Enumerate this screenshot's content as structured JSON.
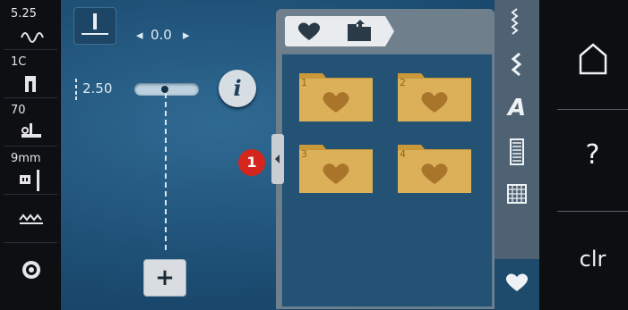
{
  "left_sidebar": {
    "items": [
      {
        "label": "5.25",
        "icon": "stitch-length-icon"
      },
      {
        "label": "1C",
        "icon": "presser-foot-icon"
      },
      {
        "label": "70",
        "icon": "needle-tension-icon"
      },
      {
        "label": "9mm",
        "icon": "stitch-width-plate-icon"
      },
      {
        "label": "",
        "icon": "feed-dog-icon"
      },
      {
        "label": "",
        "icon": "bobbin-thread-icon"
      }
    ]
  },
  "stitch_view": {
    "needle_position_value": "0.0",
    "stitch_width_value": "2.50",
    "info_label": "i",
    "add_label": "+"
  },
  "folder_panel": {
    "breadcrumb": [
      {
        "icon": "heart-icon"
      },
      {
        "icon": "folder-upload-icon"
      }
    ],
    "folders": [
      {
        "number": "1"
      },
      {
        "number": "2"
      },
      {
        "number": "3"
      },
      {
        "number": "4"
      }
    ],
    "callout_badge": "1"
  },
  "categories": [
    {
      "icon": "decorative-stitch-icon",
      "active": false
    },
    {
      "icon": "practical-stitch-icon",
      "active": false
    },
    {
      "icon": "alphabet-icon",
      "label": "A",
      "active": false
    },
    {
      "icon": "buttonhole-icon",
      "active": false
    },
    {
      "icon": "quilt-stitch-icon",
      "active": false
    },
    {
      "icon": "personal-memory-heart-icon",
      "active": true
    }
  ],
  "system_bar": {
    "home_icon": "home-icon",
    "help_label": "?",
    "clear_label": "clr"
  },
  "colors": {
    "folder_fill": "#d9ac4e",
    "heart_fill": "#a8752b",
    "badge": "#d4261c"
  }
}
